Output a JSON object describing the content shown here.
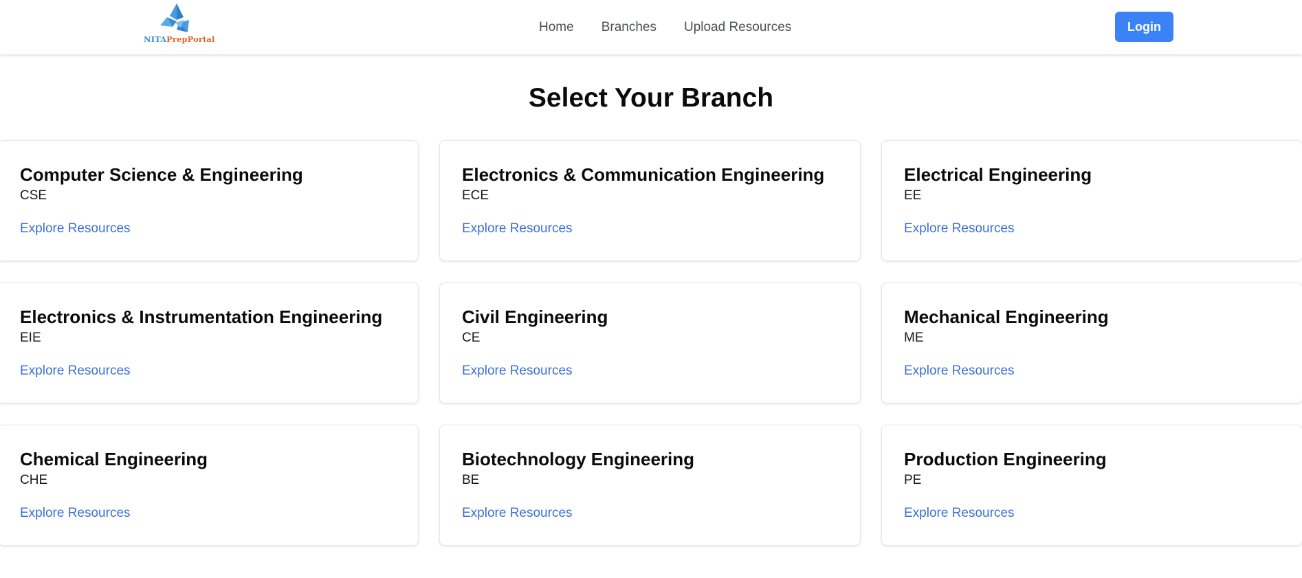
{
  "header": {
    "logo": {
      "text_part1": "NITA",
      "text_part2": "PrepPortal",
      "icon": "triangle-logo-icon",
      "colors": {
        "primary": "#3b8fd9",
        "accent": "#e0662b"
      }
    },
    "nav": [
      {
        "label": "Home"
      },
      {
        "label": "Branches"
      },
      {
        "label": "Upload Resources"
      }
    ],
    "login_label": "Login",
    "login_color": "#3b82f6"
  },
  "main": {
    "title": "Select Your Branch",
    "link_color": "#3b6fd8",
    "branches": [
      {
        "name": "Computer Science & Engineering",
        "code": "CSE",
        "link": "Explore Resources"
      },
      {
        "name": "Electronics & Communication Engineering",
        "code": "ECE",
        "link": "Explore Resources"
      },
      {
        "name": "Electrical Engineering",
        "code": "EE",
        "link": "Explore Resources"
      },
      {
        "name": "Electronics & Instrumentation Engineering",
        "code": "EIE",
        "link": "Explore Resources"
      },
      {
        "name": "Civil Engineering",
        "code": "CE",
        "link": "Explore Resources"
      },
      {
        "name": "Mechanical Engineering",
        "code": "ME",
        "link": "Explore Resources"
      },
      {
        "name": "Chemical Engineering",
        "code": "CHE",
        "link": "Explore Resources"
      },
      {
        "name": "Biotechnology Engineering",
        "code": "BE",
        "link": "Explore Resources"
      },
      {
        "name": "Production Engineering",
        "code": "PE",
        "link": "Explore Resources"
      }
    ]
  }
}
